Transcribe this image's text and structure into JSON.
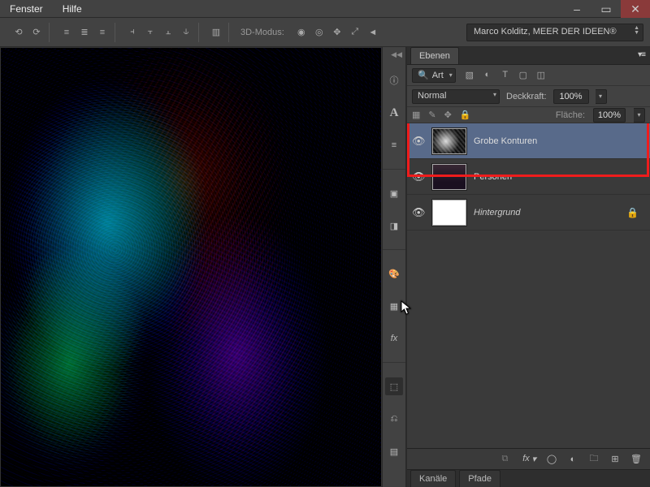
{
  "menu": {
    "fenster": "Fenster",
    "hilfe": "Hilfe"
  },
  "window_controls": {
    "min": "–",
    "max": "▭",
    "close": "✕"
  },
  "options_bar": {
    "mode_label": "3D-Modus:",
    "workspace": "Marco Kolditz, MEER DER IDEEN®"
  },
  "layers_panel": {
    "tab": "Ebenen",
    "search_kind": "Art",
    "blend_mode": "Normal",
    "opacity_label": "Deckkraft:",
    "opacity_value": "100%",
    "fill_label": "Fläche:",
    "fill_value": "100%",
    "layers": [
      {
        "name": "Grobe Konturen"
      },
      {
        "name": "Personen"
      },
      {
        "name": "Hintergrund"
      }
    ]
  },
  "bottom_panel": {
    "tab1": "Kanäle",
    "tab2": "Pfade"
  },
  "footer_fx": "fx"
}
